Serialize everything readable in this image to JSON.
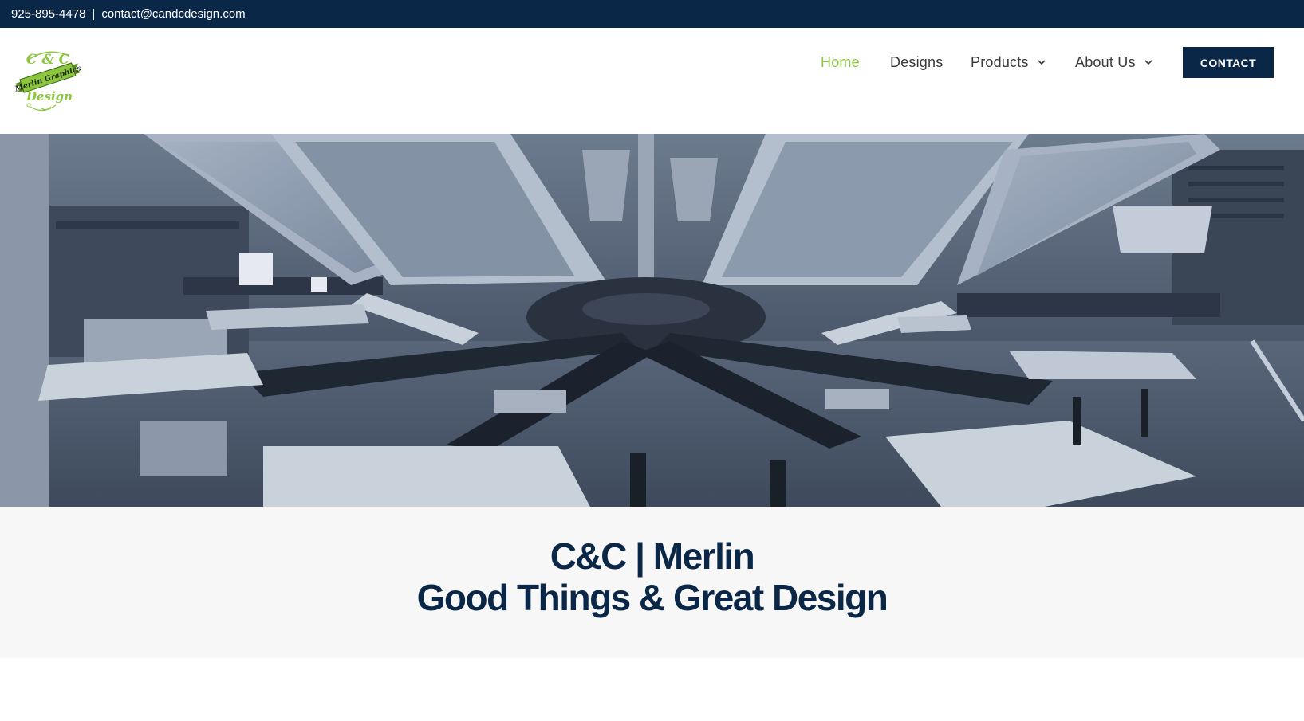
{
  "topbar": {
    "phone": "925-895-4478",
    "separator": "|",
    "email": "contact@candcdesign.com"
  },
  "logo": {
    "top_text": "C & C",
    "banner_text": "Merlin Graphics",
    "bottom_text": "Design"
  },
  "nav": {
    "items": [
      {
        "label": "Home",
        "active": true
      },
      {
        "label": "Designs",
        "active": false
      },
      {
        "label": "Products",
        "active": false,
        "dropdown": true
      },
      {
        "label": "About Us",
        "active": false,
        "dropdown": true
      }
    ],
    "contact_label": "CONTACT"
  },
  "hero": {
    "image": "screen-printing-press-photo"
  },
  "tagline": {
    "line1": "C&C | Merlin",
    "line2": "Good Things & Great Design"
  },
  "colors": {
    "navy": "#0b2748",
    "accent_green": "#8cc63f",
    "nav_text": "#3a3a3a",
    "tagline_bg": "#f7f7f7"
  }
}
